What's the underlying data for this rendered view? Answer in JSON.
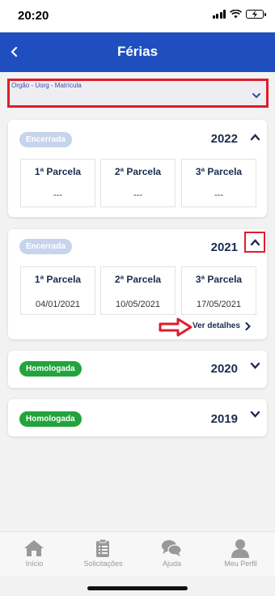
{
  "status": {
    "time": "20:20"
  },
  "header": {
    "title": "Férias"
  },
  "filter": {
    "label": "Orgão - Uorg - Matrícula"
  },
  "cards": [
    {
      "status": "Encerrada",
      "year": "2022",
      "parcels": [
        {
          "label": "1ª Parcela",
          "value": "---"
        },
        {
          "label": "2ª Parcela",
          "value": "---"
        },
        {
          "label": "3ª Parcela",
          "value": "---"
        }
      ]
    },
    {
      "status": "Encerrada",
      "year": "2021",
      "parcels": [
        {
          "label": "1ª Parcela",
          "value": "04/01/2021"
        },
        {
          "label": "2ª Parcela",
          "value": "10/05/2021"
        },
        {
          "label": "3ª Parcela",
          "value": "17/05/2021"
        }
      ],
      "details_label": "Ver detalhes"
    },
    {
      "status": "Homologada",
      "year": "2020"
    },
    {
      "status": "Homologada",
      "year": "2019"
    }
  ],
  "tabs": [
    {
      "label": "Início",
      "icon": "home-icon"
    },
    {
      "label": "Solicitações",
      "icon": "clipboard-icon"
    },
    {
      "label": "Ajuda",
      "icon": "chat-icon"
    },
    {
      "label": "Meu Perfil",
      "icon": "user-icon"
    }
  ],
  "colors": {
    "header": "#1f4fbf",
    "annotation": "#dd1e2c",
    "approved": "#23a33c",
    "closed": "#c6d4ec"
  }
}
